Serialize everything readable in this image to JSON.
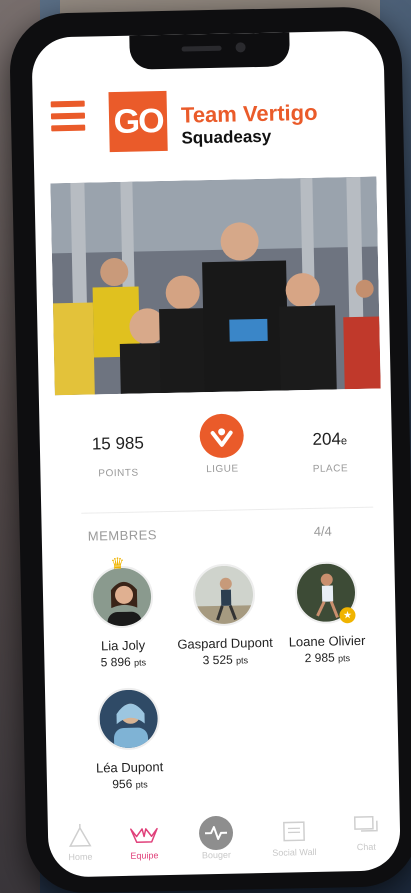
{
  "header": {
    "logo_text": "GO",
    "team_name": "Team Vertigo",
    "app_name": "Squadeasy"
  },
  "stats": {
    "points_value": "15 985",
    "points_label": "POINTS",
    "ligue_label": "LIGUE",
    "place_value": "204",
    "place_suffix": "e",
    "place_label": "PLACE"
  },
  "members": {
    "title": "MEMBRES",
    "count": "4/4",
    "list": [
      {
        "name": "Lia Joly",
        "points": "5 896",
        "unit": "pts"
      },
      {
        "name": "Gaspard Dupont",
        "points": "3 525",
        "unit": "pts"
      },
      {
        "name": "Loane Olivier",
        "points": "2 985",
        "unit": "pts"
      },
      {
        "name": "Léa Dupont",
        "points": "956",
        "unit": "pts"
      }
    ]
  },
  "tabs": [
    {
      "label": "Home",
      "icon": "home-icon"
    },
    {
      "label": "Equipe",
      "icon": "team-icon"
    },
    {
      "label": "Bouger",
      "icon": "activity-icon"
    },
    {
      "label": "Social Wall",
      "icon": "social-wall-icon"
    },
    {
      "label": "Chat",
      "icon": "chat-icon"
    }
  ],
  "colors": {
    "accent": "#ea5b2a",
    "active_tab": "#e0407a",
    "gold": "#f0b400"
  }
}
